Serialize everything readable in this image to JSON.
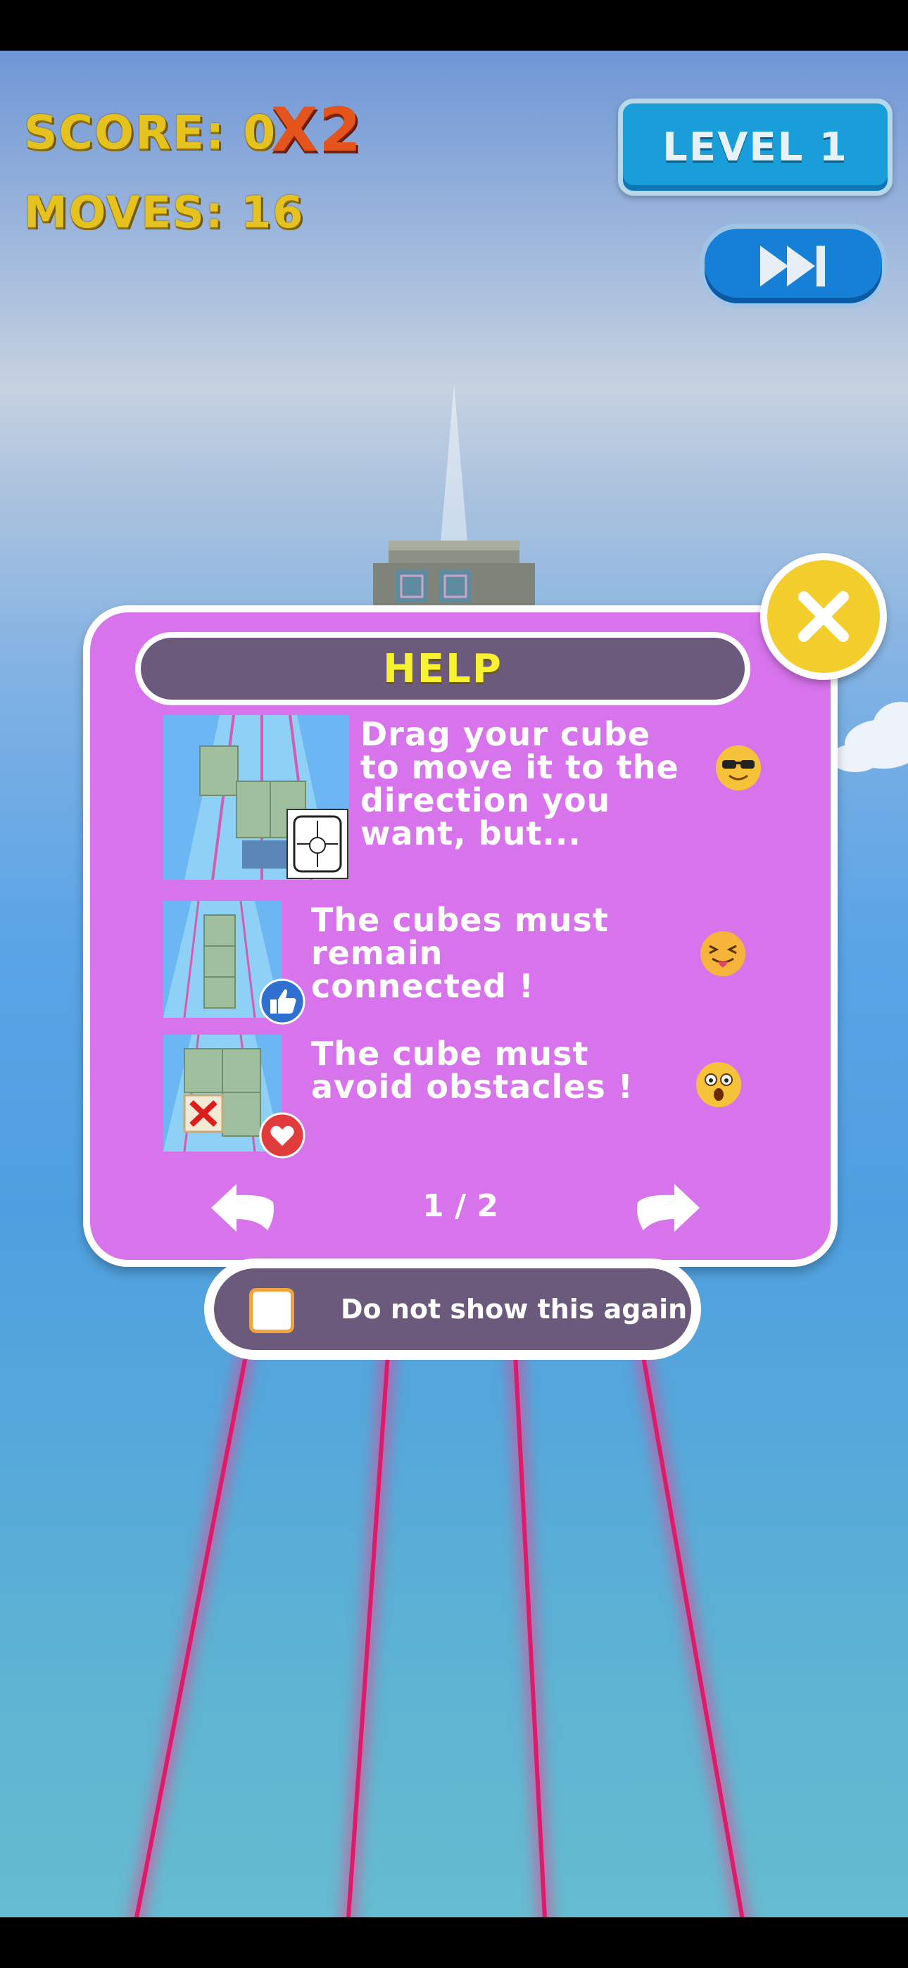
{
  "hud": {
    "score_label": "SCORE: 0",
    "multiplier": "X2",
    "moves_label": "MOVES: 16",
    "level_label": "LEVEL 1",
    "skip_icon": "skip-forward-icon"
  },
  "help": {
    "title": "HELP",
    "close_icon": "close-icon",
    "tips": [
      {
        "text": "Drag your cube to move it to the direction you want, but...",
        "emoji": "sunglasses-emoji"
      },
      {
        "text": "The cubes must remain connected !",
        "emoji": "tongue-out-emoji"
      },
      {
        "text": "The cube must avoid obstacles !",
        "emoji": "shocked-emoji"
      }
    ],
    "page_indicator": "1 / 2",
    "prev_icon": "arrow-left-icon",
    "next_icon": "arrow-right-icon"
  },
  "dont_show": {
    "label": "Do not show this again",
    "checked": false
  },
  "colors": {
    "panel": "#d774ec",
    "title_text": "#f8f12f",
    "hud_gold": "#e5c21d",
    "multiplier": "#e4541b",
    "button_blue": "#1a9ed9",
    "rail_pink": "#e01a6a"
  }
}
